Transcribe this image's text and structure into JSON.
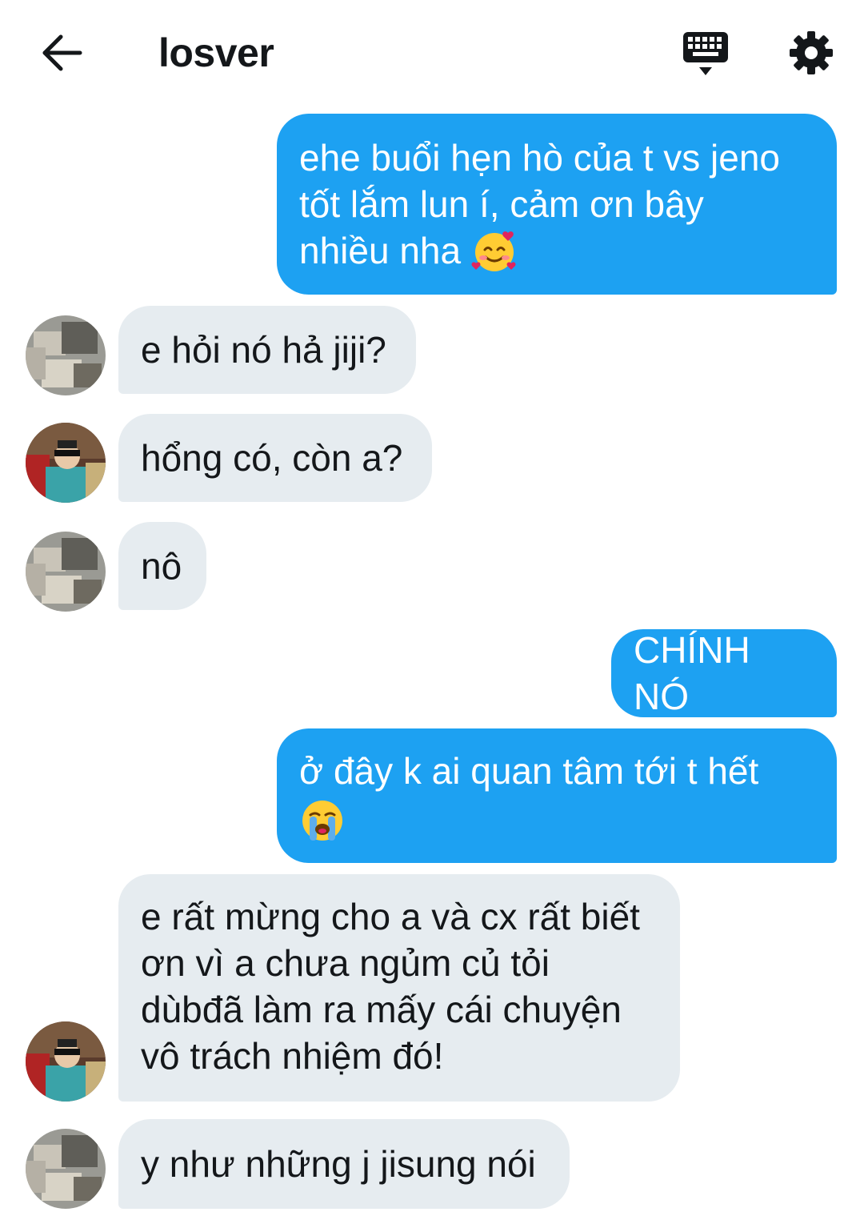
{
  "header": {
    "title": "losver",
    "back_icon": "arrow-left-icon",
    "keyboard_icon": "keyboard-icon",
    "settings_icon": "gear-icon"
  },
  "colors": {
    "sent_bubble": "#1da1f2",
    "received_bubble": "#e6ecf0",
    "text_dark": "#14171a"
  },
  "messages": [
    {
      "side": "sent",
      "text": "ehe buổi hẹn hò của t vs jeno\ntốt lắm lun í, cảm ơn bây\nnhiều nha",
      "emoji": "smiling-face-with-hearts"
    },
    {
      "side": "received",
      "avatar": "avatar-camo",
      "text": "e hỏi nó hả jiji?"
    },
    {
      "side": "received",
      "avatar": "avatar-teal-jacket",
      "text": "hổng có, còn a?"
    },
    {
      "side": "received",
      "avatar": "avatar-camo",
      "text": "nô"
    },
    {
      "side": "sent",
      "text": "CHÍNH NÓ"
    },
    {
      "side": "sent",
      "text": "ở đây k ai quan tâm tới t hết",
      "emoji": "loudly-crying-face"
    },
    {
      "side": "received",
      "avatar": "avatar-teal-jacket",
      "text": "e rất mừng cho a và cx rất biết\nơn vì a chưa ngủm củ tỏi\ndùbđã làm ra mấy cái chuyện\nvô trách nhiệm đó!"
    },
    {
      "side": "received",
      "avatar": "avatar-camo",
      "text": "y như những j jisung nói"
    }
  ]
}
